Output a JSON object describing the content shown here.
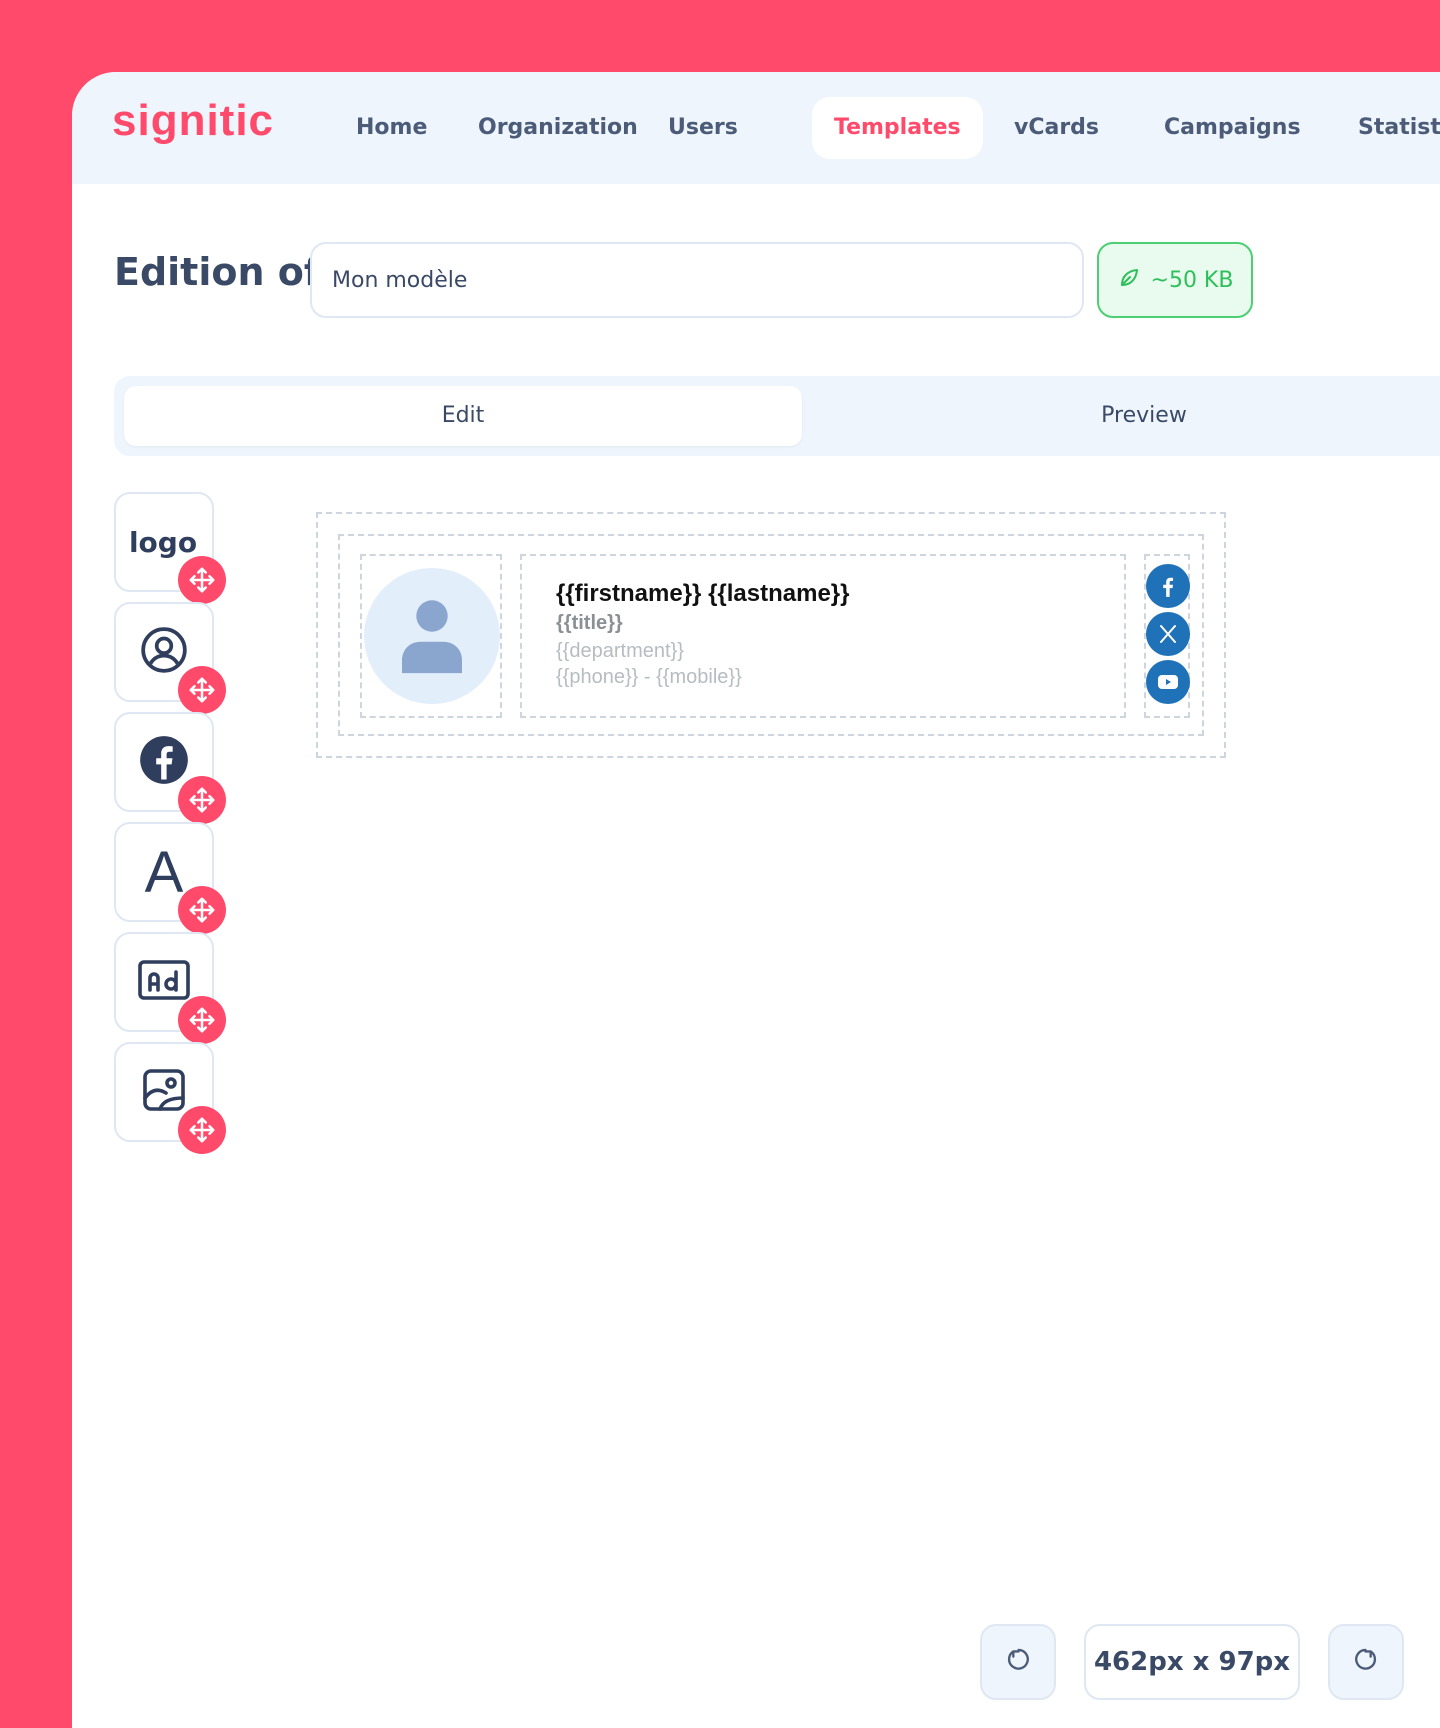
{
  "brand": {
    "name": "signitic"
  },
  "nav": {
    "items": [
      {
        "label": "Home"
      },
      {
        "label": "Organization"
      },
      {
        "label": "Users"
      },
      {
        "label": "Templates",
        "active": true
      },
      {
        "label": "vCards"
      },
      {
        "label": "Campaigns"
      },
      {
        "label": "Statistic"
      }
    ]
  },
  "editor": {
    "title_prefix": "Edition of",
    "template_name": "Mon modèle",
    "weight_label": "~50 KB",
    "tabs": [
      {
        "label": "Edit",
        "active": true
      },
      {
        "label": "Preview"
      }
    ]
  },
  "palette": {
    "items": [
      {
        "icon": "logo-block-icon",
        "label": "logo"
      },
      {
        "icon": "user-circle-icon"
      },
      {
        "icon": "facebook-icon"
      },
      {
        "icon": "text-icon",
        "label": "A"
      },
      {
        "icon": "ad-banner-icon"
      },
      {
        "icon": "image-icon"
      }
    ]
  },
  "signature": {
    "name_line": "{{firstname}} {{lastname}}",
    "title_line": "{{title}}",
    "department_line": "{{department}}",
    "phone_line": "{{phone}} - {{mobile}}",
    "social": [
      "facebook-icon",
      "x-icon",
      "youtube-icon"
    ]
  },
  "footer": {
    "dimensions": "462px x 97px"
  },
  "colors": {
    "brand": "#ff4a6b",
    "nav_bg": "#eef5fd",
    "success": "#4ccf73",
    "social": "#1f72b8"
  }
}
